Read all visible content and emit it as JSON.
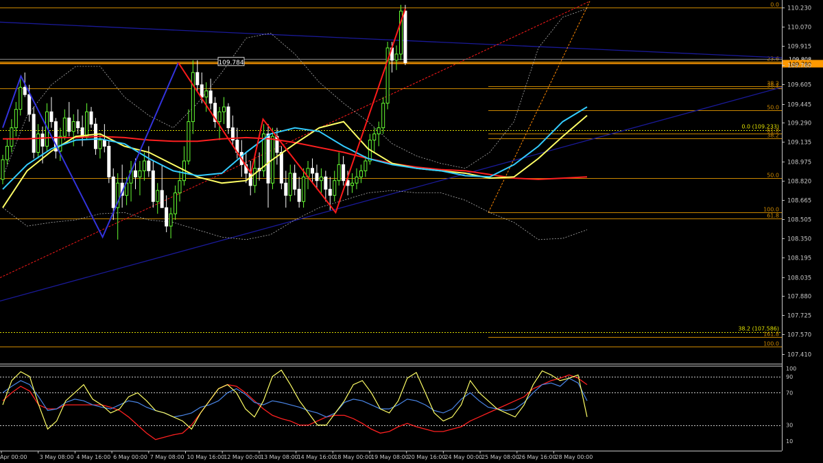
{
  "colors": {
    "background": "#000000",
    "axis": "#c8c8c8",
    "text": "#c8c8c8",
    "bull": "#66ff33",
    "bear": "#ffffff",
    "fib": "#cc8800",
    "fib_dotted": "#e0e000",
    "zigzag_blue": "#3333dd",
    "zigzag_red": "#ff1a1a",
    "trend_navy": "#1a1a99",
    "ma_cyan": "#33ccff",
    "ma_yellow": "#ffff66",
    "ma_red": "#ff2020",
    "bollinger": "#b0b0b0",
    "osc_yellow": "#ffff66",
    "osc_blue": "#4a86e8",
    "osc_red": "#ff2020"
  },
  "chart_data": {
    "type": "candlestick",
    "price_axis": {
      "range": [
        107.33,
        110.29
      ],
      "ticks": [
        "110.230",
        "110.070",
        "109.915",
        "109.760",
        "109.605",
        "109.445",
        "109.290",
        "109.135",
        "108.975",
        "108.820",
        "108.665",
        "108.505",
        "108.350",
        "108.195",
        "108.035",
        "107.880",
        "107.725",
        "107.570",
        "107.410"
      ]
    },
    "current_price_label": "109.780",
    "current_price": 109.778,
    "bid_price": 109.808,
    "bid_label": "109.808",
    "peak_label": "109.784",
    "peak_value": 109.784,
    "time_axis": [
      "Apr 00:00",
      "3 May 08:00",
      "4 May 16:00",
      "6 May 00:00",
      "7 May 08:00",
      "10 May 16:00",
      "12 May 00:00",
      "13 May 08:00",
      "14 May 16:00",
      "18 May 00:00",
      "19 May 08:00",
      "20 May 16:00",
      "24 May 00:00",
      "25 May 08:00",
      "26 May 16:00",
      "28 May 00:00"
    ],
    "fib_levels": [
      {
        "label": "0.0",
        "value": 110.23,
        "full": true
      },
      {
        "label": "23.6",
        "value": 109.79,
        "full": true
      },
      {
        "label": "38.2",
        "value": 109.57,
        "full": true
      },
      {
        "label": "50.0",
        "value": 108.843,
        "full": true
      },
      {
        "label": "61.8",
        "value": 108.512,
        "full": true
      },
      {
        "label": "100.0",
        "value": 107.467,
        "full": true
      },
      {
        "label": "38.2",
        "value": 109.588,
        "full": false
      },
      {
        "label": "50.0",
        "value": 109.395,
        "full": false
      },
      {
        "label": "61.8",
        "value": 109.205,
        "full": false
      },
      {
        "label": "38.2",
        "value": 109.165,
        "full": false
      },
      {
        "label": "100.0",
        "value": 108.56,
        "full": false
      },
      {
        "label": "161.8",
        "value": 107.55,
        "full": false
      }
    ],
    "fib_dotted": [
      {
        "label": "0.0 (109.233)",
        "value": 109.233
      },
      {
        "label": "38.2 (107.586)",
        "value": 107.586
      }
    ],
    "candles": [
      [
        108.83,
        109.03,
        108.79,
        108.99
      ],
      [
        108.99,
        109.16,
        108.95,
        109.1
      ],
      [
        109.1,
        109.32,
        109.05,
        109.25
      ],
      [
        109.25,
        109.46,
        109.18,
        109.4
      ],
      [
        109.4,
        109.66,
        109.35,
        109.58
      ],
      [
        109.58,
        109.7,
        109.5,
        109.52
      ],
      [
        109.52,
        109.6,
        109.3,
        109.36
      ],
      [
        109.36,
        109.42,
        109.0,
        109.05
      ],
      [
        109.05,
        109.28,
        109.0,
        109.2
      ],
      [
        109.2,
        109.26,
        108.96,
        109.1
      ],
      [
        109.1,
        109.45,
        109.05,
        109.38
      ],
      [
        109.38,
        109.5,
        109.25,
        109.3
      ],
      [
        109.3,
        109.33,
        109.0,
        109.06
      ],
      [
        109.06,
        109.25,
        108.98,
        109.18
      ],
      [
        109.18,
        109.4,
        109.15,
        109.33
      ],
      [
        109.33,
        109.46,
        109.18,
        109.22
      ],
      [
        109.22,
        109.36,
        109.1,
        109.3
      ],
      [
        109.3,
        109.4,
        109.2,
        109.25
      ],
      [
        109.25,
        109.35,
        109.1,
        109.18
      ],
      [
        109.18,
        109.45,
        109.15,
        109.38
      ],
      [
        109.38,
        109.42,
        109.25,
        109.28
      ],
      [
        109.28,
        109.33,
        109.03,
        109.08
      ],
      [
        109.08,
        109.2,
        109.0,
        109.15
      ],
      [
        109.15,
        109.28,
        109.05,
        109.1
      ],
      [
        109.1,
        109.15,
        108.8,
        108.85
      ],
      [
        108.85,
        108.92,
        108.5,
        108.6
      ],
      [
        108.6,
        108.88,
        108.34,
        108.8
      ],
      [
        108.8,
        108.95,
        108.6,
        108.7
      ],
      [
        108.7,
        108.85,
        108.62,
        108.8
      ],
      [
        108.8,
        108.98,
        108.65,
        108.9
      ],
      [
        108.9,
        109.0,
        108.75,
        108.85
      ],
      [
        108.85,
        108.98,
        108.7,
        108.9
      ],
      [
        108.9,
        109.05,
        108.82,
        108.98
      ],
      [
        108.98,
        109.1,
        108.85,
        108.9
      ],
      [
        108.9,
        108.98,
        108.6,
        108.65
      ],
      [
        108.65,
        108.8,
        108.55,
        108.74
      ],
      [
        108.74,
        108.95,
        108.65,
        108.6
      ],
      [
        108.6,
        108.7,
        108.4,
        108.45
      ],
      [
        108.45,
        108.6,
        108.35,
        108.55
      ],
      [
        108.55,
        108.78,
        108.5,
        108.72
      ],
      [
        108.72,
        108.9,
        108.65,
        108.82
      ],
      [
        108.82,
        109.1,
        108.78,
        108.98
      ],
      [
        108.98,
        109.4,
        108.95,
        109.3
      ],
      [
        109.3,
        109.8,
        109.2,
        109.7
      ],
      [
        109.7,
        109.8,
        109.55,
        109.6
      ],
      [
        109.6,
        109.7,
        109.45,
        109.5
      ],
      [
        109.5,
        109.62,
        109.38,
        109.55
      ],
      [
        109.55,
        109.65,
        109.4,
        109.45
      ],
      [
        109.45,
        109.5,
        109.25,
        109.3
      ],
      [
        109.3,
        109.42,
        109.15,
        109.38
      ],
      [
        109.38,
        109.5,
        109.28,
        109.42
      ],
      [
        109.42,
        109.45,
        109.2,
        109.25
      ],
      [
        109.25,
        109.35,
        109.1,
        109.15
      ],
      [
        109.15,
        109.25,
        109.0,
        109.05
      ],
      [
        109.05,
        109.15,
        108.85,
        108.95
      ],
      [
        108.95,
        109.05,
        108.8,
        108.88
      ],
      [
        108.88,
        108.98,
        108.7,
        108.78
      ],
      [
        108.78,
        109.0,
        108.72,
        108.92
      ],
      [
        108.92,
        109.05,
        108.82,
        108.9
      ],
      [
        108.9,
        109.28,
        108.85,
        109.2
      ],
      [
        109.2,
        109.28,
        108.6,
        108.8
      ],
      [
        108.8,
        109.25,
        108.75,
        109.18
      ],
      [
        109.18,
        109.25,
        108.95,
        109.05
      ],
      [
        109.05,
        109.1,
        108.75,
        108.8
      ],
      [
        108.8,
        108.9,
        108.6,
        108.7
      ],
      [
        108.7,
        108.95,
        108.65,
        108.88
      ],
      [
        108.88,
        108.95,
        108.7,
        108.75
      ],
      [
        108.75,
        108.85,
        108.6,
        108.65
      ],
      [
        108.65,
        108.92,
        108.6,
        108.85
      ],
      [
        108.85,
        108.98,
        108.75,
        108.92
      ],
      [
        108.92,
        109.0,
        108.8,
        108.88
      ],
      [
        108.88,
        108.95,
        108.75,
        108.82
      ],
      [
        108.82,
        108.92,
        108.72,
        108.85
      ],
      [
        108.85,
        108.9,
        108.65,
        108.75
      ],
      [
        108.75,
        108.85,
        108.58,
        108.7
      ],
      [
        108.7,
        108.9,
        108.65,
        108.82
      ],
      [
        108.82,
        109.05,
        108.78,
        108.95
      ],
      [
        108.95,
        109.02,
        108.78,
        108.82
      ],
      [
        108.82,
        108.9,
        108.7,
        108.78
      ],
      [
        108.78,
        108.88,
        108.72,
        108.8
      ],
      [
        108.8,
        108.92,
        108.75,
        108.85
      ],
      [
        108.85,
        108.95,
        108.8,
        108.9
      ],
      [
        108.9,
        109.02,
        108.85,
        108.98
      ],
      [
        108.98,
        109.2,
        108.95,
        109.15
      ],
      [
        109.15,
        109.25,
        109.05,
        109.2
      ],
      [
        109.2,
        109.3,
        109.1,
        109.25
      ],
      [
        109.25,
        109.5,
        109.2,
        109.45
      ],
      [
        109.45,
        109.95,
        109.4,
        109.9
      ],
      [
        109.9,
        109.95,
        109.7,
        109.8
      ],
      [
        109.8,
        109.92,
        109.72,
        109.85
      ],
      [
        109.85,
        110.25,
        109.8,
        110.2
      ],
      [
        110.2,
        110.25,
        109.76,
        109.78
      ]
    ],
    "ma_yellow": [
      108.6,
      108.9,
      109.06,
      109.18,
      109.2,
      109.1,
      109.05,
      108.95,
      108.85,
      108.8,
      108.82,
      108.98,
      109.12,
      109.25,
      109.3,
      109.08,
      108.96,
      108.92,
      108.9,
      108.88,
      108.84,
      108.85,
      109.0,
      109.18,
      109.35
    ],
    "ma_cyan": [
      108.75,
      108.95,
      109.08,
      109.15,
      109.16,
      109.12,
      109.0,
      108.9,
      108.86,
      108.88,
      109.05,
      109.2,
      109.25,
      109.22,
      109.1,
      109.0,
      108.95,
      108.92,
      108.9,
      108.86,
      108.85,
      108.95,
      109.1,
      109.3,
      109.42
    ],
    "ma_red": [
      109.16,
      109.16,
      109.17,
      109.17,
      109.18,
      109.17,
      109.15,
      109.14,
      109.14,
      109.16,
      109.17,
      109.16,
      109.13,
      109.09,
      109.05,
      109.0,
      108.96,
      108.93,
      108.91,
      108.9,
      108.87,
      108.84,
      108.83,
      108.84,
      108.85
    ],
    "boll_upper": [
      108.85,
      109.35,
      109.6,
      109.75,
      109.75,
      109.5,
      109.35,
      109.25,
      109.45,
      109.7,
      109.98,
      110.02,
      109.85,
      109.62,
      109.45,
      109.3,
      109.12,
      109.02,
      108.96,
      108.92,
      109.05,
      109.3,
      109.9,
      110.15,
      110.22
    ],
    "boll_lower": [
      108.6,
      108.45,
      108.48,
      108.5,
      108.55,
      108.56,
      108.5,
      108.48,
      108.42,
      108.36,
      108.34,
      108.38,
      108.5,
      108.6,
      108.66,
      108.72,
      108.74,
      108.72,
      108.72,
      108.66,
      108.56,
      108.48,
      108.34,
      108.35,
      108.42
    ],
    "zigzag_blue": [
      [
        0,
        109.25
      ],
      [
        6,
        109.67
      ],
      [
        33,
        108.36
      ],
      [
        58,
        109.78
      ]
    ],
    "zigzag_red": [
      [
        58,
        109.78
      ],
      [
        82,
        108.88
      ],
      [
        86,
        109.32
      ],
      [
        110,
        108.56
      ],
      [
        133,
        110.22
      ]
    ],
    "oscillator": {
      "levels": [
        10,
        30,
        70,
        90,
        100
      ],
      "level_labels": [
        "100",
        "90",
        "70",
        "30",
        "10"
      ],
      "yellow": [
        55,
        85,
        96,
        90,
        55,
        25,
        35,
        60,
        70,
        80,
        62,
        55,
        45,
        50,
        65,
        70,
        60,
        48,
        45,
        40,
        35,
        25,
        45,
        60,
        75,
        80,
        70,
        50,
        40,
        60,
        90,
        98,
        80,
        60,
        45,
        30,
        30,
        45,
        60,
        80,
        85,
        70,
        50,
        45,
        60,
        88,
        95,
        70,
        45,
        35,
        40,
        55,
        85,
        70,
        60,
        50,
        45,
        40,
        55,
        80,
        97,
        92,
        85,
        88,
        92,
        40
      ],
      "blue": [
        70,
        78,
        85,
        80,
        65,
        48,
        50,
        58,
        62,
        60,
        55,
        52,
        50,
        55,
        60,
        58,
        52,
        48,
        45,
        40,
        42,
        45,
        52,
        55,
        60,
        70,
        75,
        68,
        58,
        55,
        60,
        58,
        55,
        52,
        48,
        45,
        40,
        45,
        58,
        62,
        60,
        55,
        50,
        50,
        55,
        62,
        60,
        55,
        48,
        45,
        50,
        62,
        70,
        60,
        52,
        50,
        48,
        50,
        58,
        70,
        80,
        82,
        78,
        88,
        82,
        60
      ],
      "red": [
        60,
        70,
        78,
        72,
        55,
        50,
        50,
        55,
        55,
        55,
        55,
        55,
        52,
        48,
        40,
        30,
        20,
        12,
        15,
        18,
        20,
        30,
        45,
        60,
        75,
        80,
        78,
        70,
        60,
        50,
        42,
        38,
        35,
        30,
        30,
        35,
        40,
        42,
        42,
        38,
        32,
        25,
        20,
        22,
        28,
        32,
        28,
        25,
        22,
        22,
        25,
        28,
        35,
        40,
        45,
        50,
        55,
        60,
        65,
        75,
        80,
        85,
        88,
        92,
        88,
        80
      ]
    }
  }
}
